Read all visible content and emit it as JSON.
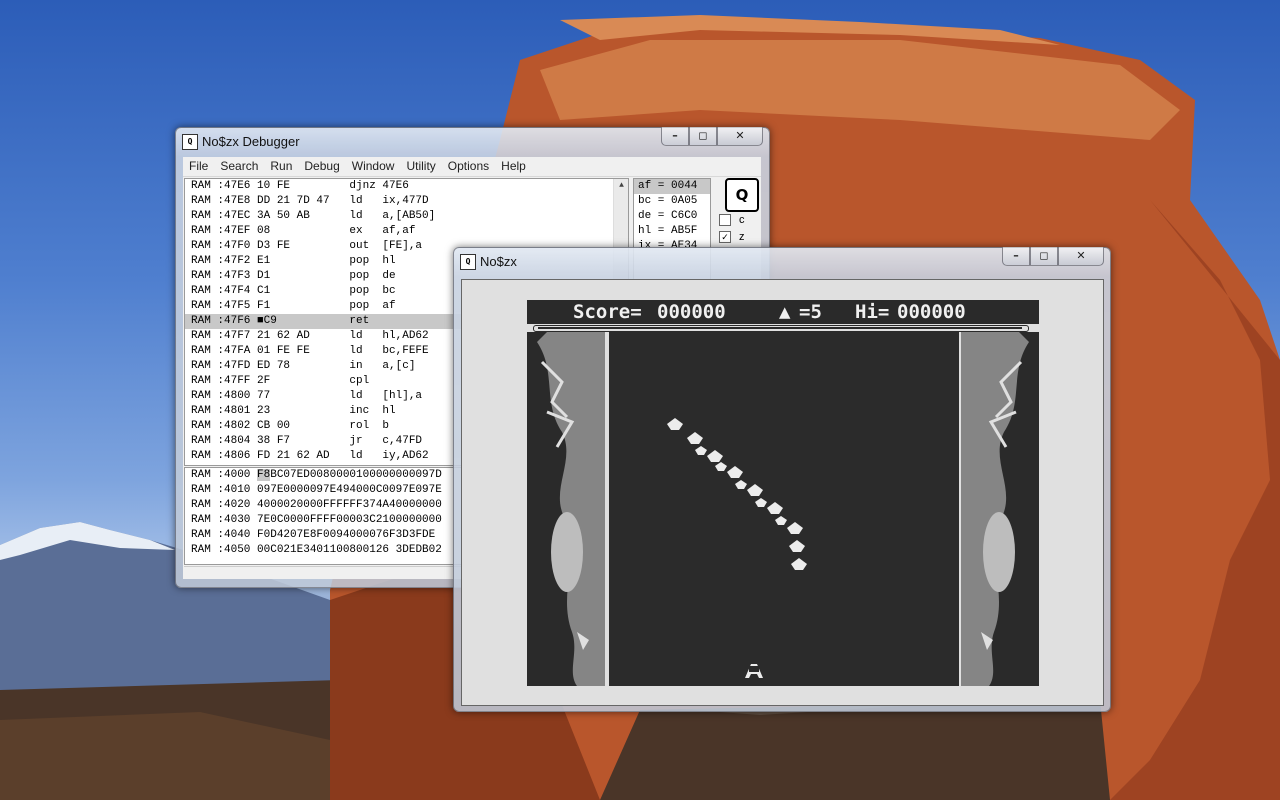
{
  "debugger": {
    "title": "No$zx Debugger",
    "icon_label": "Q̲",
    "menu": [
      "File",
      "Search",
      "Run",
      "Debug",
      "Window",
      "Utility",
      "Options",
      "Help"
    ],
    "disassembly": [
      {
        "bank": "RAM",
        "addr": ":47E6",
        "bytes": "10 FE",
        "op": "djnz",
        "args": "47E6"
      },
      {
        "bank": "RAM",
        "addr": ":47E8",
        "bytes": "DD 21 7D 47",
        "op": "ld",
        "args": "ix,477D"
      },
      {
        "bank": "RAM",
        "addr": ":47EC",
        "bytes": "3A 50 AB",
        "op": "ld",
        "args": "a,[AB50]"
      },
      {
        "bank": "RAM",
        "addr": ":47EF",
        "bytes": "08",
        "op": "ex",
        "args": "af,af"
      },
      {
        "bank": "RAM",
        "addr": ":47F0",
        "bytes": "D3 FE",
        "op": "out",
        "args": "[FE],a"
      },
      {
        "bank": "RAM",
        "addr": ":47F2",
        "bytes": "E1",
        "op": "pop",
        "args": "hl"
      },
      {
        "bank": "RAM",
        "addr": ":47F3",
        "bytes": "D1",
        "op": "pop",
        "args": "de"
      },
      {
        "bank": "RAM",
        "addr": ":47F4",
        "bytes": "C1",
        "op": "pop",
        "args": "bc"
      },
      {
        "bank": "RAM",
        "addr": ":47F5",
        "bytes": "F1",
        "op": "pop",
        "args": "af"
      },
      {
        "bank": "RAM",
        "addr": ":47F6",
        "bytes": "■C9",
        "op": "ret",
        "args": ""
      },
      {
        "bank": "RAM",
        "addr": ":47F7",
        "bytes": "21 62 AD",
        "op": "ld",
        "args": "hl,AD62"
      },
      {
        "bank": "RAM",
        "addr": ":47FA",
        "bytes": "01 FE FE",
        "op": "ld",
        "args": "bc,FEFE"
      },
      {
        "bank": "RAM",
        "addr": ":47FD",
        "bytes": "ED 78",
        "op": "in",
        "args": "a,[c]"
      },
      {
        "bank": "RAM",
        "addr": ":47FF",
        "bytes": "2F",
        "op": "cpl",
        "args": ""
      },
      {
        "bank": "RAM",
        "addr": ":4800",
        "bytes": "77",
        "op": "ld",
        "args": "[hl],a"
      },
      {
        "bank": "RAM",
        "addr": ":4801",
        "bytes": "23",
        "op": "inc",
        "args": "hl"
      },
      {
        "bank": "RAM",
        "addr": ":4802",
        "bytes": "CB 00",
        "op": "rol",
        "args": "b"
      },
      {
        "bank": "RAM",
        "addr": ":4804",
        "bytes": "38 F7",
        "op": "jr",
        "args": "c,47FD"
      },
      {
        "bank": "RAM",
        "addr": ":4806",
        "bytes": "FD 21 62 AD",
        "op": "ld",
        "args": "iy,AD62"
      }
    ],
    "registers": [
      "af = 0044",
      "bc = 0A05",
      "de = C6C0",
      "hl = AB5F",
      "ix = AE34"
    ],
    "flags": [
      {
        "name": "c",
        "checked": ""
      },
      {
        "name": "z",
        "checked": "✓"
      }
    ],
    "hexdump": [
      {
        "bank": "RAM",
        "addr": ":4000",
        "cursor": "F8",
        "data": "BC07ED0080000100000000097D"
      },
      {
        "bank": "RAM",
        "addr": ":4010",
        "cursor": "",
        "data": "097E0000097E494000C0097E097E"
      },
      {
        "bank": "RAM",
        "addr": ":4020",
        "cursor": "",
        "data": "4000020000FFFFFF374A40000000"
      },
      {
        "bank": "RAM",
        "addr": ":4030",
        "cursor": "",
        "data": "7E0C0000FFFF00003C2100000000"
      },
      {
        "bank": "RAM",
        "addr": ":4040",
        "cursor": "",
        "data": "F0D4207E8F0094000076F3D3FDE"
      },
      {
        "bank": "RAM",
        "addr": ":4050",
        "cursor": "",
        "data": "00C021E3401100800126 3DEDB02"
      }
    ]
  },
  "emulator": {
    "title": "No$zx",
    "hud": {
      "score_label": "Score=",
      "score": "000000",
      "lives_icon": "ship-icon",
      "lives": "=5",
      "hi_label": "Hi=",
      "hi": "000000"
    }
  },
  "colors": {
    "hud_bg": "#2a2a2a",
    "screen_bg": "#e0e0e0",
    "highlight": "#c8c8c8"
  }
}
